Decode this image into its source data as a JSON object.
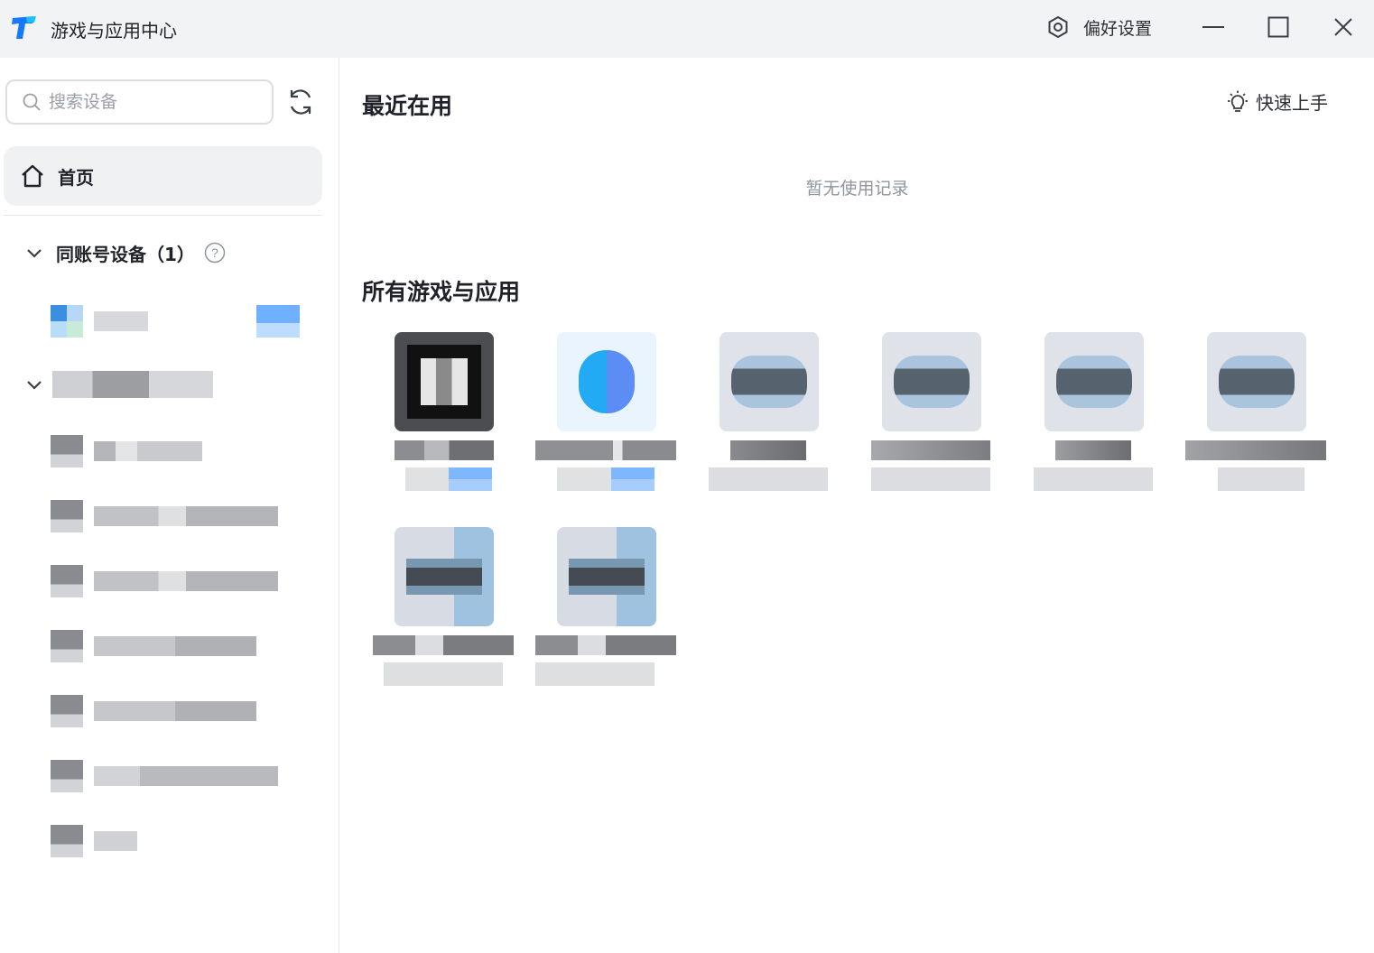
{
  "window": {
    "title": "游戏与应用中心",
    "preferences_label": "偏好设置"
  },
  "sidebar": {
    "search_placeholder": "搜索设备",
    "home_label": "首页",
    "groups": [
      {
        "title": "同账号设备（1）",
        "devices": [
          {
            "name": "",
            "has_badge": true
          }
        ]
      },
      {
        "title": "",
        "devices": [
          {
            "name": ""
          },
          {
            "name": ""
          },
          {
            "name": ""
          },
          {
            "name": ""
          },
          {
            "name": ""
          },
          {
            "name": ""
          },
          {
            "name": ""
          }
        ]
      }
    ]
  },
  "main": {
    "recent_heading": "最近在用",
    "quickstart_label": "快速上手",
    "recent_empty_text": "暂无使用记录",
    "all_heading": "所有游戏与应用",
    "apps": [
      {
        "name": "",
        "subtitle": "",
        "has_badge": true
      },
      {
        "name": "",
        "subtitle": "",
        "has_badge": true
      },
      {
        "name": "",
        "subtitle": ""
      },
      {
        "name": "",
        "subtitle": ""
      },
      {
        "name": "",
        "subtitle": ""
      },
      {
        "name": "",
        "subtitle": ""
      },
      {
        "name": "",
        "subtitle": ""
      },
      {
        "name": "",
        "subtitle": ""
      }
    ]
  },
  "colors": {
    "titlebar_bg": "#f2f3f5",
    "logo_primary": "#1677ff",
    "logo_accent": "#19c3ff",
    "home_bg": "#f0f1f3",
    "badge_blue": "#6fb0ff",
    "muted_text": "#8f959e"
  },
  "icons": {
    "logo": "app-logo",
    "preferences": "settings-hexagon-icon",
    "minimize": "minimize-icon",
    "maximize": "maximize-icon",
    "close": "close-icon",
    "search": "search-icon",
    "refresh": "refresh-icon",
    "home": "home-icon",
    "collapse": "chevron-down-icon",
    "help": "question-circle-icon",
    "quickstart": "lightbulb-icon"
  }
}
